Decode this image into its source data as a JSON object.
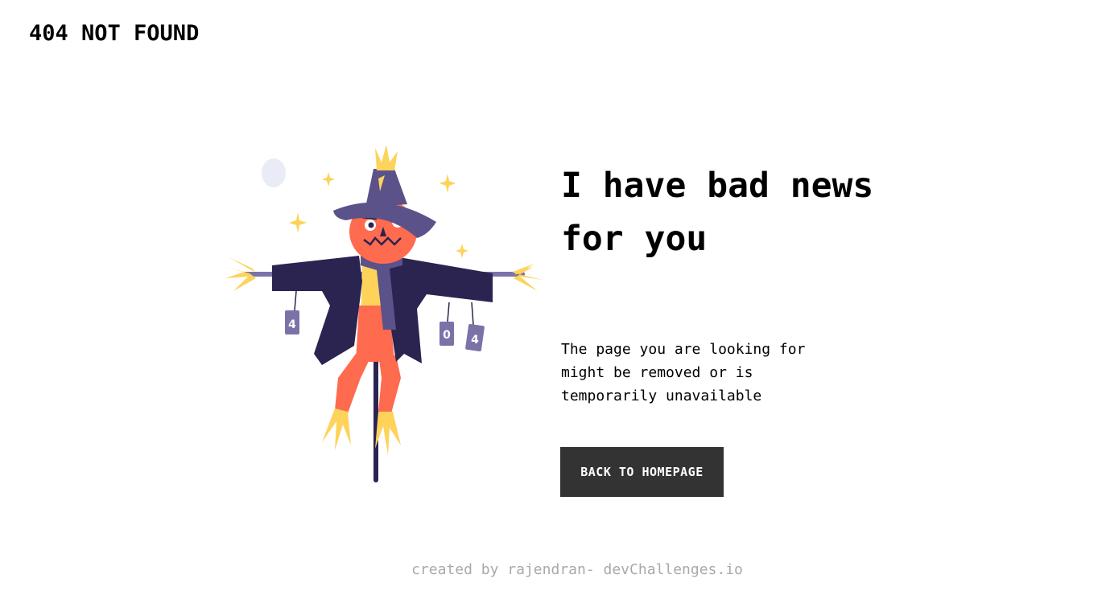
{
  "header": {
    "logo_text": "404 NOT FOUND"
  },
  "illustration": {
    "name": "scarecrow-illustration",
    "can_labels": [
      "4",
      "0",
      "4"
    ]
  },
  "main": {
    "headline": "I have bad news for you",
    "description": "The page you are looking for might be removed or is temporarily unavailable",
    "button_label": "BACK TO HOMEPAGE"
  },
  "footer": {
    "credit": "created by rajendran- devChallenges.io"
  },
  "colors": {
    "button_bg": "#333333",
    "footer_text": "#a9a9a9",
    "coat": "#2b2350",
    "hat": "#5c528a",
    "face": "#fe6b4e",
    "straw": "#fdd35a",
    "moon": "#e9ecf6"
  }
}
